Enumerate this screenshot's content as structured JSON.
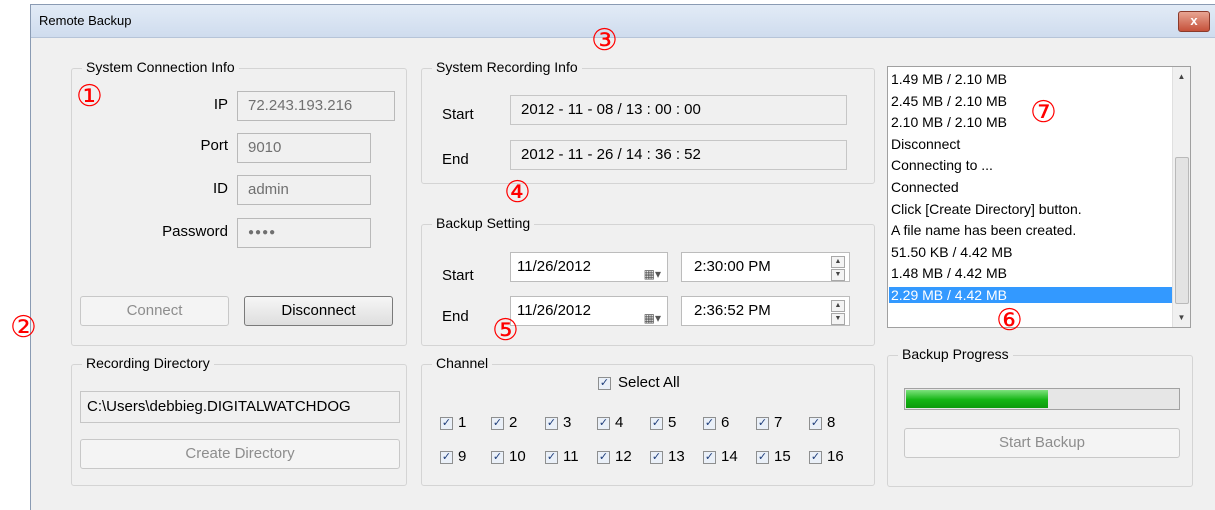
{
  "window": {
    "title": "Remote Backup",
    "close_glyph": "x"
  },
  "connection": {
    "legend": "System Connection Info",
    "ip_label": "IP",
    "ip_value": "72.243.193.216",
    "port_label": "Port",
    "port_value": "9010",
    "id_label": "ID",
    "id_value": "admin",
    "password_label": "Password",
    "password_value": "●●●●",
    "connect_label": "Connect",
    "disconnect_label": "Disconnect"
  },
  "recording_info": {
    "legend": "System Recording Info",
    "start_label": "Start",
    "start_value": "2012 - 11 - 08  /  13 : 00 : 00",
    "end_label": "End",
    "end_value": "2012 - 11 - 26  /  14 : 36 : 52"
  },
  "backup_setting": {
    "legend": "Backup Setting",
    "start_label": "Start",
    "start_date": "11/26/2012",
    "start_time": "2:30:00 PM",
    "end_label": "End",
    "end_date": "11/26/2012",
    "end_time": "2:36:52 PM"
  },
  "directory": {
    "legend": "Recording Directory",
    "path": "C:\\Users\\debbieg.DIGITALWATCHDOG",
    "create_label": "Create Directory"
  },
  "channel": {
    "legend": "Channel",
    "select_all_label": "Select All",
    "select_all_checked": true,
    "channels": [
      "1",
      "2",
      "3",
      "4",
      "5",
      "6",
      "7",
      "8",
      "9",
      "10",
      "11",
      "12",
      "13",
      "14",
      "15",
      "16"
    ]
  },
  "log": {
    "lines": [
      "1.49 MB / 2.10 MB",
      "2.45 MB / 2.10 MB",
      "2.10 MB / 2.10 MB",
      "Disconnect",
      "Connecting to ...",
      "Connected",
      "Click [Create Directory] button.",
      "A file name has been created.",
      "51.50 KB / 4.42 MB",
      "1.48 MB / 4.42 MB",
      "2.29 MB / 4.42 MB"
    ],
    "selected_index": 10
  },
  "backup_progress": {
    "legend": "Backup Progress",
    "percent": 52,
    "start_label": "Start Backup"
  },
  "annotations": [
    "①",
    "②",
    "③",
    "④",
    "⑤",
    "⑥",
    "⑦"
  ],
  "colors": {
    "annotation": "#ff0000",
    "selection": "#3399ff",
    "progress": "#14b514"
  }
}
